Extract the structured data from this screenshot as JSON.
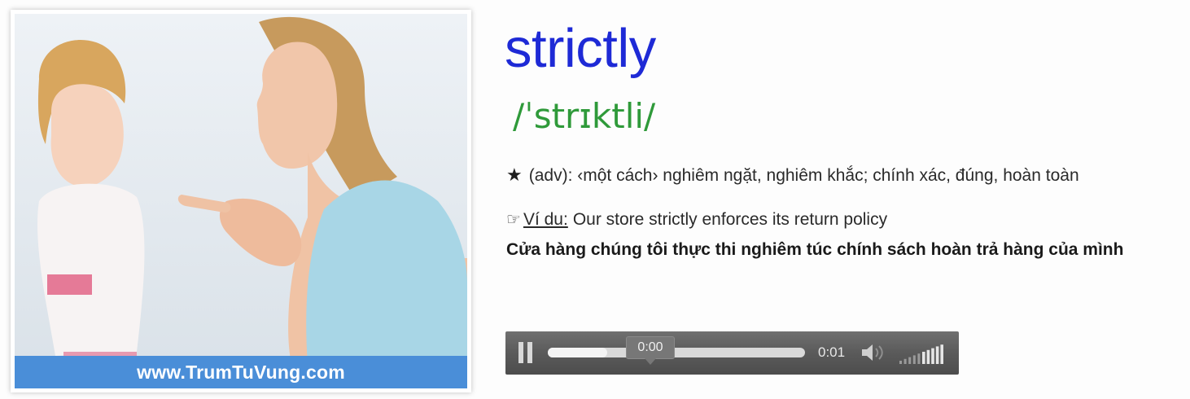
{
  "image": {
    "watermark": "www.TrumTuVung.com",
    "colors": {
      "watermark_band": "#4a8ed8"
    }
  },
  "word": {
    "headword": "strictly",
    "ipa": "/ˈstrɪktli/",
    "meaning": "(adv): ‹một cách› nghiêm ngặt, nghiêm khắc; chính xác, đúng, hoàn toàn",
    "example_label": "Ví du:",
    "example_text": "Our store strictly enforces its return policy",
    "translation": "Cửa hàng chúng tôi thực thi nghiêm túc chính sách hoàn trả hàng của mình",
    "icons": {
      "meaning": "star-icon",
      "example": "pointing-hand-icon"
    },
    "colors": {
      "headword": "#1e2ad6",
      "ipa": "#2f9a3a"
    }
  },
  "player": {
    "tooltip_time": "0:00",
    "total_time": "0:01",
    "progress": 0.23,
    "volume_level": 5,
    "icons": {
      "play_state": "pause-icon",
      "volume": "speaker-icon",
      "volume_level": "volume-bars-icon"
    }
  }
}
